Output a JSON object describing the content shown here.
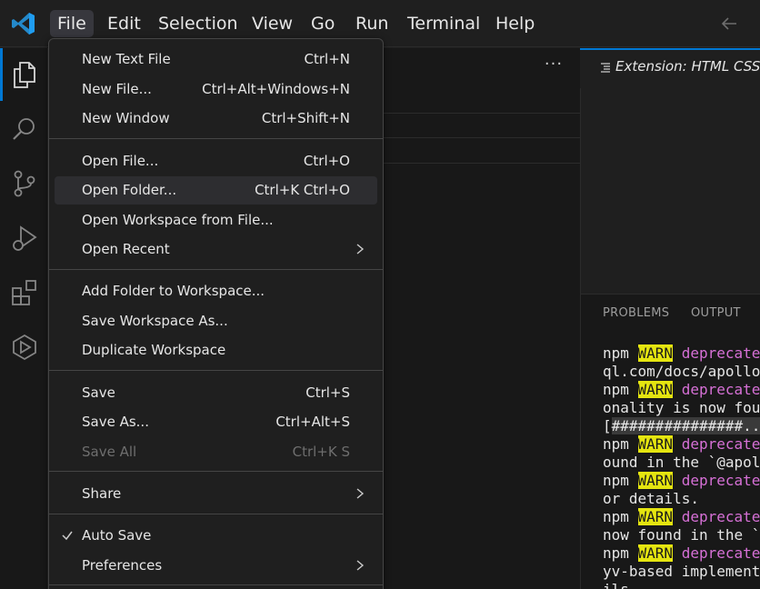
{
  "menubar": {
    "items": [
      "File",
      "Edit",
      "Selection",
      "View",
      "Go",
      "Run",
      "Terminal",
      "Help"
    ]
  },
  "file_menu": {
    "groups": [
      [
        {
          "label": "New Text File",
          "shortcut": "Ctrl+N"
        },
        {
          "label": "New File...",
          "shortcut": "Ctrl+Alt+Windows+N"
        },
        {
          "label": "New Window",
          "shortcut": "Ctrl+Shift+N"
        }
      ],
      [
        {
          "label": "Open File...",
          "shortcut": "Ctrl+O"
        },
        {
          "label": "Open Folder...",
          "shortcut": "Ctrl+K Ctrl+O"
        },
        {
          "label": "Open Workspace from File...",
          "shortcut": ""
        },
        {
          "label": "Open Recent",
          "shortcut": ""
        }
      ],
      [
        {
          "label": "Add Folder to Workspace...",
          "shortcut": ""
        },
        {
          "label": "Save Workspace As...",
          "shortcut": ""
        },
        {
          "label": "Duplicate Workspace",
          "shortcut": ""
        }
      ],
      [
        {
          "label": "Save",
          "shortcut": "Ctrl+S"
        },
        {
          "label": "Save As...",
          "shortcut": "Ctrl+Alt+S"
        },
        {
          "label": "Save All",
          "shortcut": "Ctrl+K S"
        }
      ],
      [
        {
          "label": "Share",
          "shortcut": ""
        }
      ],
      [
        {
          "label": "Auto Save",
          "shortcut": ""
        },
        {
          "label": "Preferences",
          "shortcut": ""
        }
      ]
    ]
  },
  "editor": {
    "tab_label": "Extension: HTML CSS S"
  },
  "panel": {
    "tabs": [
      "PROBLEMS",
      "OUTPUT"
    ]
  },
  "terminal": {
    "lines": [
      [
        "npm ",
        "WARN",
        " deprecated"
      ],
      [
        "ql.com/docs/apollo-"
      ],
      [
        "npm ",
        "WARN",
        " deprecated"
      ],
      [
        "onality is now found"
      ],
      [
        "[",
        "###############..",
        ""
      ],
      [
        "npm ",
        "WARN",
        " deprecated"
      ],
      [
        "ound in the `@apollo"
      ],
      [
        "npm ",
        "WARN",
        " deprecated"
      ],
      [
        "or details."
      ],
      [
        "npm ",
        "WARN",
        " deprecated"
      ],
      [
        "now found in the `@a"
      ],
      [
        "npm ",
        "WARN",
        " deprecated"
      ],
      [
        "yv-based implementat"
      ],
      [
        "ils."
      ]
    ]
  },
  "colors": {
    "accent": "#0078d4",
    "warn_bg": "#e5e510",
    "deprecated": "#d670d6"
  }
}
